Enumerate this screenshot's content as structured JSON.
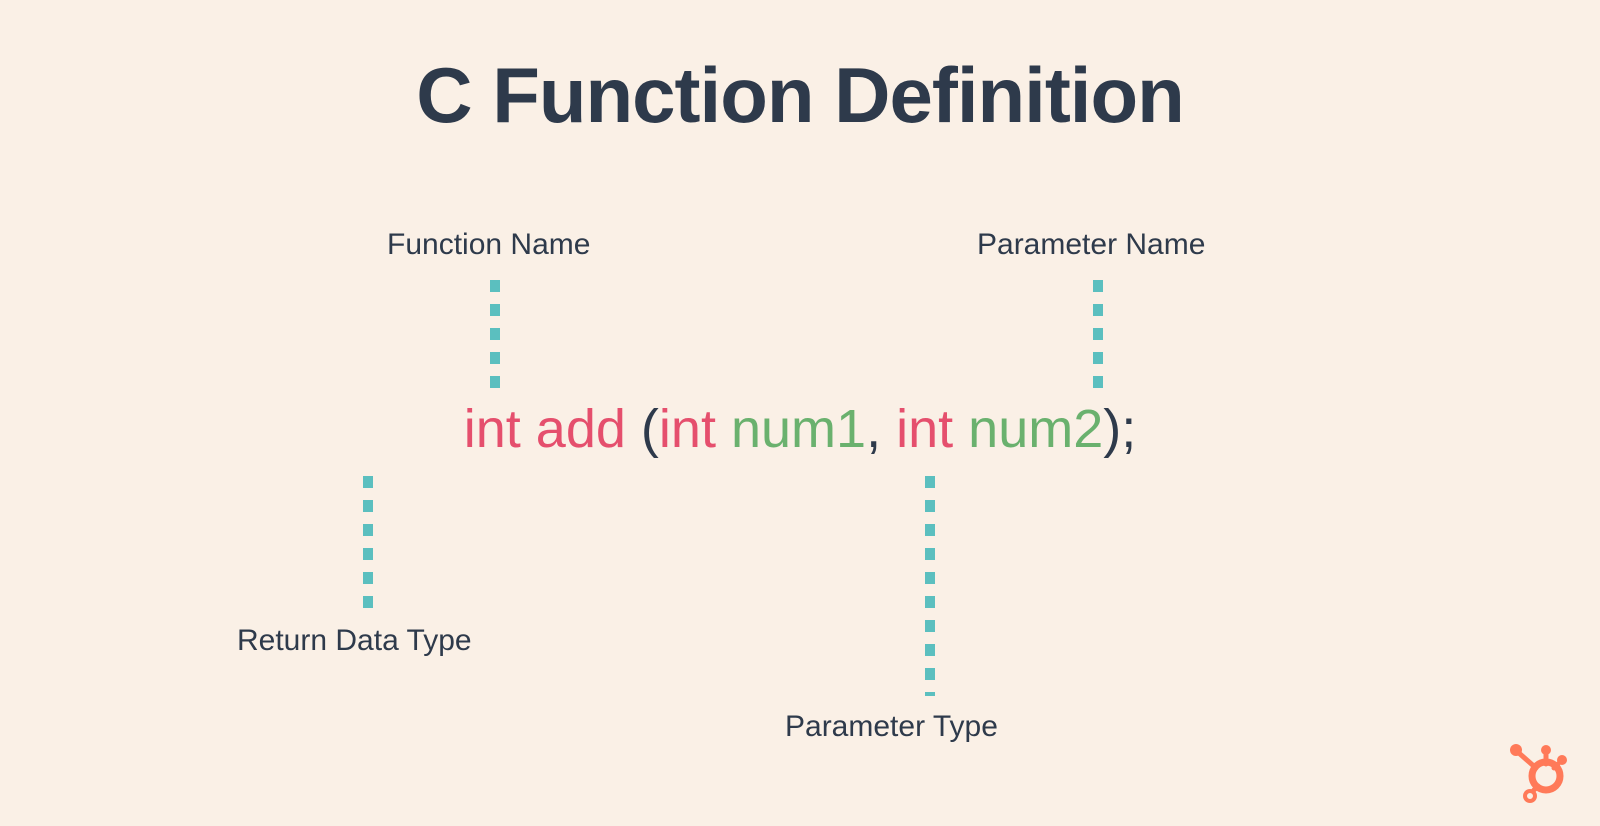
{
  "title": "C Function Definition",
  "labels": {
    "function_name": "Function Name",
    "parameter_name": "Parameter Name",
    "return_type": "Return Data Type",
    "parameter_type": "Parameter Type"
  },
  "code": {
    "return_keyword": "int",
    "function_name": "add",
    "open_paren": "(",
    "param1_type": "int",
    "param1_name": "num1",
    "comma": ",",
    "param2_type": "int",
    "param2_name": "num2",
    "close": ");"
  },
  "colors": {
    "background": "#faf0e6",
    "text_dark": "#2e3a4b",
    "pink": "#e54f6d",
    "green": "#6ab16e",
    "teal": "#5bbfbf",
    "orange": "#ff7a59"
  }
}
